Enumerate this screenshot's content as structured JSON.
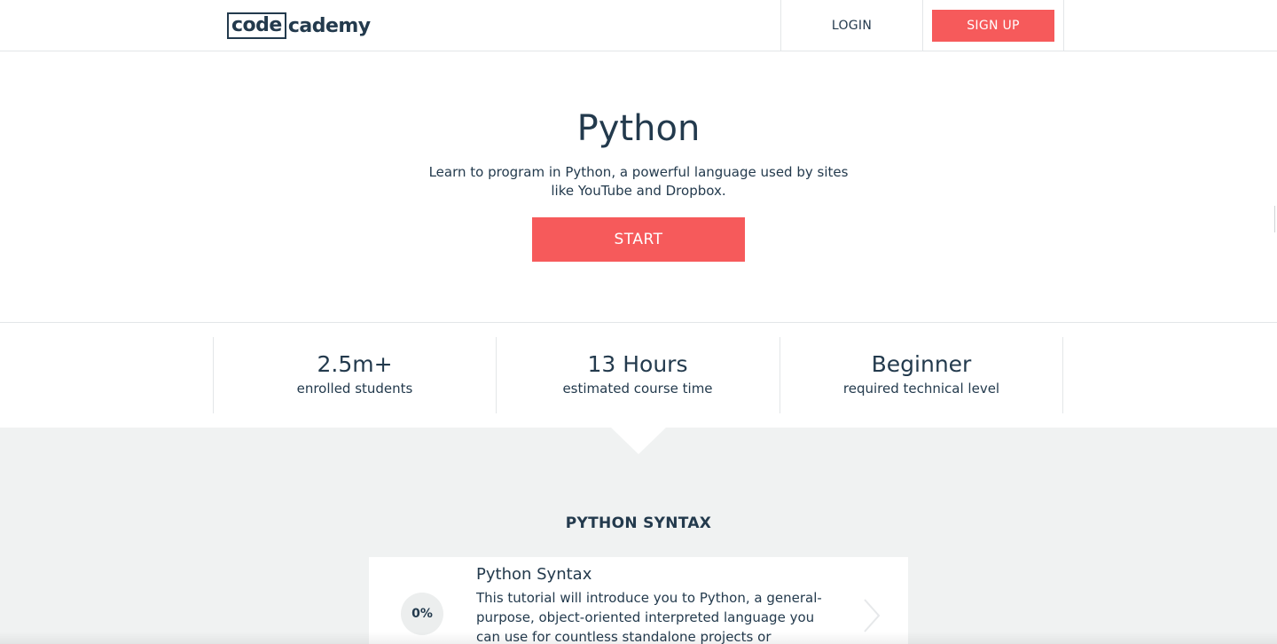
{
  "header": {
    "logo_left": "code",
    "logo_right": "cademy",
    "login_label": "LOGIN",
    "signup_label": "SIGN UP"
  },
  "hero": {
    "title": "Python",
    "description": "Learn to program in Python, a powerful language used by sites like YouTube and Dropbox.",
    "start_label": "START"
  },
  "stats": [
    {
      "value": "2.5m+",
      "label": "enrolled students"
    },
    {
      "value": "13 Hours",
      "label": "estimated course time"
    },
    {
      "value": "Beginner",
      "label": "required technical level"
    }
  ],
  "syllabus": {
    "section_title": "PYTHON SYNTAX",
    "lessons": [
      {
        "progress": "0%",
        "title": "Python Syntax",
        "description": "This tutorial will introduce you to Python, a general-purpose, object-oriented interpreted language you can use for countless standalone projects or scripting"
      }
    ]
  },
  "colors": {
    "accent": "#f65a5b",
    "text": "#233a4d",
    "panel_bg": "#f0f2f2",
    "divider": "#e3e6e8"
  }
}
